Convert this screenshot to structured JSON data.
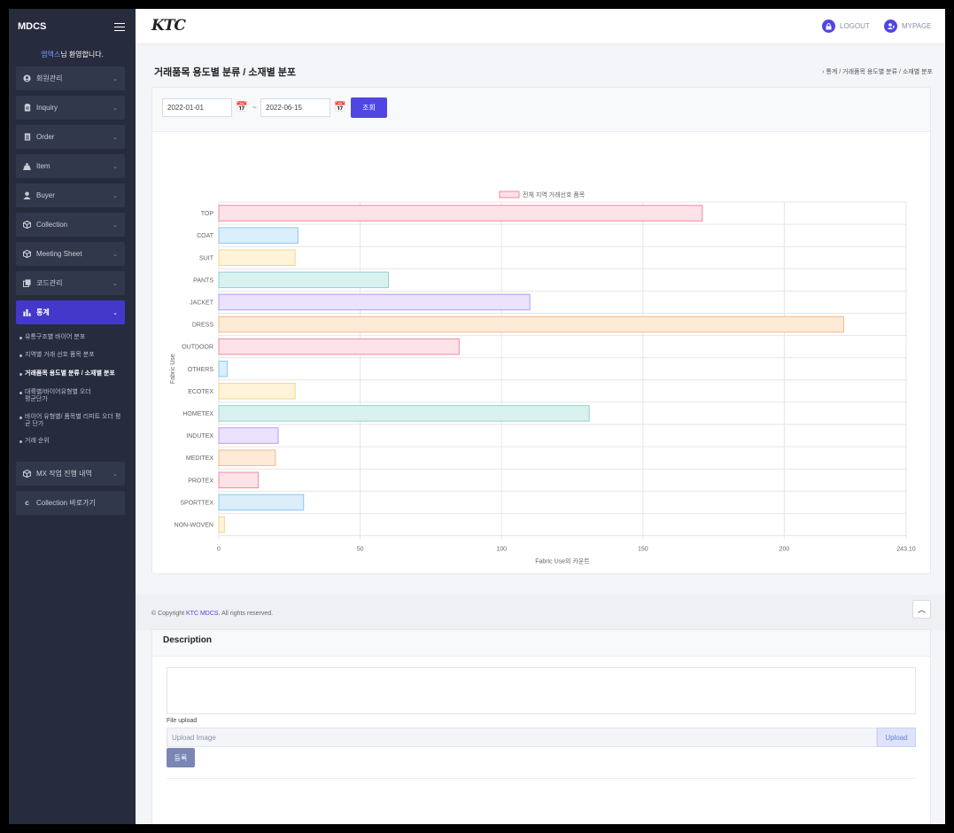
{
  "sidebar": {
    "brand": "MDCS",
    "welcome_name": "엠엑스",
    "welcome_suffix": "님 환영합니다.",
    "menu": [
      {
        "label": "회원관리",
        "icon": "user-circle-icon"
      },
      {
        "label": "Inquiry",
        "icon": "clipboard-icon"
      },
      {
        "label": "Order",
        "icon": "list-icon"
      },
      {
        "label": "Item",
        "icon": "scale-icon"
      },
      {
        "label": "Buyer",
        "icon": "user-icon"
      },
      {
        "label": "Collection",
        "icon": "box-icon"
      },
      {
        "label": "Meeting Sheet",
        "icon": "box-icon"
      },
      {
        "label": "코드관리",
        "icon": "copy-icon"
      },
      {
        "label": "통계",
        "icon": "bar-chart-icon",
        "active": true
      }
    ],
    "submenu": [
      "유통구조별 바이어 분포",
      "지역별 거래 선호 품목 분포",
      "거래품목 용도별 분류 / 소재별 분포",
      "대륙별/바이어유형별 오더평균단가",
      "바이어 유형별/ 품목별 리피트 오더 평균 단가",
      "거래 순위"
    ],
    "active_submenu_index": 2,
    "menu_bottom": [
      {
        "label": "MX 작업 진행 내역",
        "icon": "box-icon"
      },
      {
        "label": "Collection 바로가기",
        "icon": "c-icon"
      }
    ]
  },
  "topbar": {
    "logo": "KTC",
    "logout_label": "LOGOUT",
    "mypage_label": "MYPAGE"
  },
  "page": {
    "title": "거래품목 용도별 분류 / 소재별 분포",
    "breadcrumb": "통계 / 거래품목 용도별 분류 / 소재별 분포"
  },
  "filter": {
    "start_date": "2022-01-01",
    "separator": "~",
    "end_date": "2022-06-15",
    "search_label": "조회"
  },
  "colors": {
    "accent": "#4f46e5",
    "sidebar_bg": "#262c3d"
  },
  "chart_data": {
    "type": "bar",
    "orientation": "horizontal",
    "legend": "전체 지역 거래선호 품목",
    "legend_position": "top",
    "ylabel": "Fabric Use",
    "xlabel": "Fabric Use의 카운트",
    "xlim": [
      0,
      243.1
    ],
    "xticks": [
      "0",
      "50",
      "100",
      "150",
      "200",
      "243.10"
    ],
    "grid": true,
    "categories": [
      "TOP",
      "COAT",
      "SUIT",
      "PANTS",
      "JACKET",
      "DRESS",
      "OUTDOOR",
      "OTHERS",
      "ECOTEX",
      "HOMETEX",
      "INDUTEX",
      "MEDITEX",
      "PROTEX",
      "SPORTTEX",
      "NON-WOVEN"
    ],
    "values": [
      171,
      28,
      27,
      60,
      110,
      221,
      85,
      3,
      27,
      131,
      21,
      20,
      14,
      30,
      2
    ],
    "bar_fill": [
      "#fde2e7",
      "#dbeefb",
      "#fff4d9",
      "#d9f2ef",
      "#ebe2fe",
      "#fdebd8",
      "#fde2e7",
      "#dbeefb",
      "#fff4d9",
      "#d9f2ef",
      "#ebe2fe",
      "#fdebd8",
      "#fde2e7",
      "#dbeefb",
      "#fff4d9"
    ],
    "bar_stroke": [
      "#f08aa0",
      "#8ec6ee",
      "#f5d489",
      "#8fd3cb",
      "#b79cf5",
      "#f3b98a",
      "#f08aa0",
      "#8ec6ee",
      "#f5d489",
      "#8fd3cb",
      "#b79cf5",
      "#f3b98a",
      "#f08aa0",
      "#8ec6ee",
      "#f5d489"
    ]
  },
  "footer": {
    "copyright_prefix": "© Copyright ",
    "copyright_brand": "KTC MDCS",
    "copyright_suffix": ". All rights reserved."
  },
  "description": {
    "title": "Description",
    "file_label": "File upload",
    "file_placeholder": "Upload Image",
    "upload_label": "Upload",
    "register_label": "등록"
  }
}
